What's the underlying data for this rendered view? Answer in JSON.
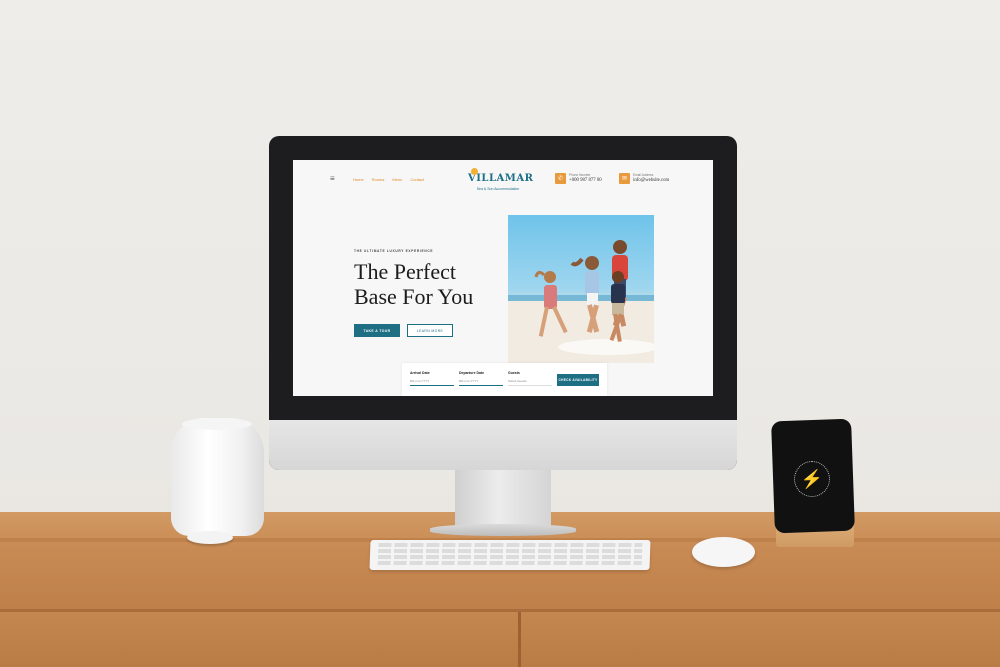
{
  "site": {
    "nav": {
      "menu_icon": "hamburger-icon",
      "items": [
        "Home",
        "Rooms",
        "Menu",
        "Contact"
      ]
    },
    "logo": {
      "name": "VILLAMAR",
      "tagline": "Sea & Sun Accommodation"
    },
    "phone": {
      "label": "Phone Number",
      "value": "+000 987 877 00",
      "icon": "phone-icon"
    },
    "email": {
      "label": "Email Address",
      "value": "info@website.com",
      "icon": "mail-icon"
    },
    "hero": {
      "eyebrow": "THE ULTIMATE LUXURY EXPERIENCE",
      "title_line1": "The Perfect",
      "title_line2": "Base For You",
      "primary_button": "TAKE A TOUR",
      "secondary_button": "LEARN MORE"
    },
    "booking": {
      "arrival_label": "Arrival Date",
      "arrival_value": "DD-mm-YYYY",
      "departure_label": "Departure Date",
      "departure_value": "DD-mm-YYYY",
      "guests_label": "Guests",
      "guests_value": "Select Guests",
      "submit": "CHECK AVAILABILITY"
    },
    "colors": {
      "accent": "#1e6e84",
      "orange": "#e89a3c"
    }
  },
  "device": {
    "phone_icon": "lightning-bolt-icon"
  }
}
